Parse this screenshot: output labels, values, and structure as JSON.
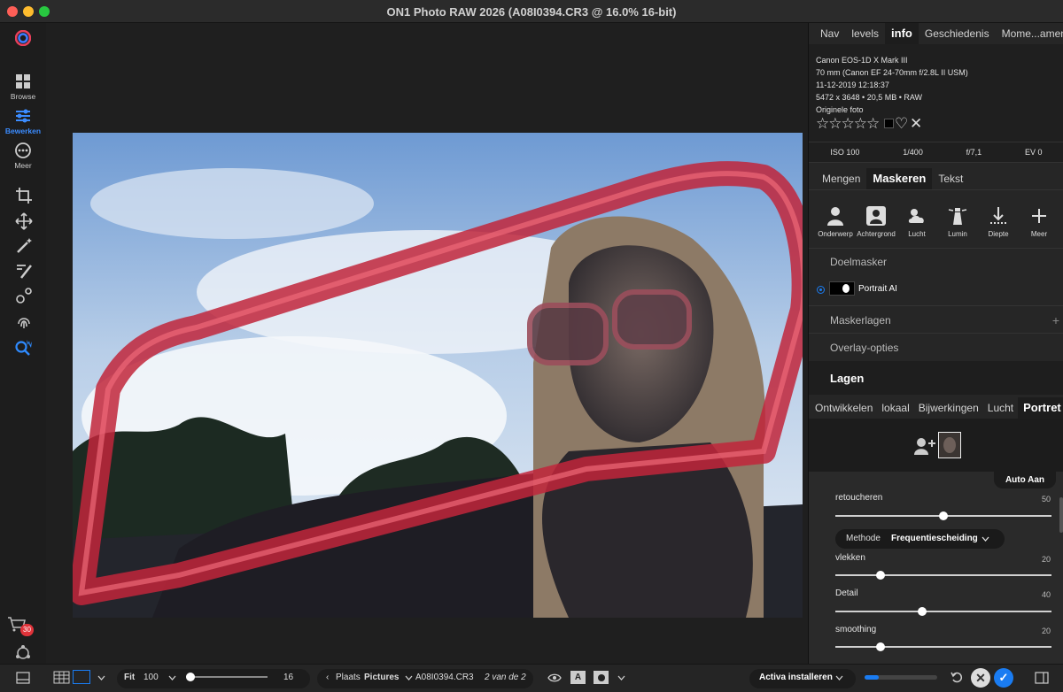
{
  "window": {
    "title": "ON1 Photo RAW 2026 (A08I0394.CR3 @ 16.0% 16-bit)"
  },
  "leftnav": {
    "browse": "Browse",
    "edit": "Bewerken",
    "more": "Meer",
    "cart_badge": "30"
  },
  "top_tabs": [
    "Nav",
    "levels",
    "info",
    "Geschiedenis",
    "Mome...amen"
  ],
  "info": {
    "camera": "Canon EOS-1D X Mark III",
    "lens": "70 mm (Canon EF 24-70mm f/2.8L II USM)",
    "datetime": "11-12-2019 12:18:37",
    "dims": "5472 x 3648 • 20,5 MB • RAW",
    "original": "Originele foto",
    "iso": "ISO 100",
    "shutter": "1/400",
    "aperture": "f/7,1",
    "ev": "EV 0"
  },
  "mask_tabs": [
    "Mengen",
    "Maskeren",
    "Tekst"
  ],
  "mask_tools": [
    "Onderwerp",
    "Achtergrond",
    "Lucht",
    "Lumin",
    "Diepte",
    "Meer"
  ],
  "doelmasker": "Doelmasker",
  "mask_name": "Portrait AI",
  "maskerlagen": "Maskerlagen",
  "overlay": "Overlay-opties",
  "lagen": "Lagen",
  "layer_tabs": [
    "Ontwikkelen",
    "lokaal",
    "Bijwerkingen",
    "Lucht",
    "Portret"
  ],
  "auto_btn": "Auto Aan",
  "sliders": {
    "retoucheren": {
      "label": "retoucheren",
      "value": "50"
    },
    "vlekken": {
      "label": "vlekken",
      "value": "20"
    },
    "detail": {
      "label": "Detail",
      "value": "40"
    },
    "smoothing": {
      "label": "smoothing",
      "value": "20"
    }
  },
  "methode": {
    "label": "Methode",
    "value": "Frequentiescheiding"
  },
  "bottom": {
    "fit": "Fit",
    "zoom": "100",
    "size": "16",
    "plaats": "Plaats",
    "folder": "Pictures",
    "file": "A08I0394.CR3",
    "count": "2 van de 2",
    "activa": "Activa installeren"
  },
  "colors": {
    "accent": "#1a7cf2",
    "badge": "#e0333a"
  }
}
